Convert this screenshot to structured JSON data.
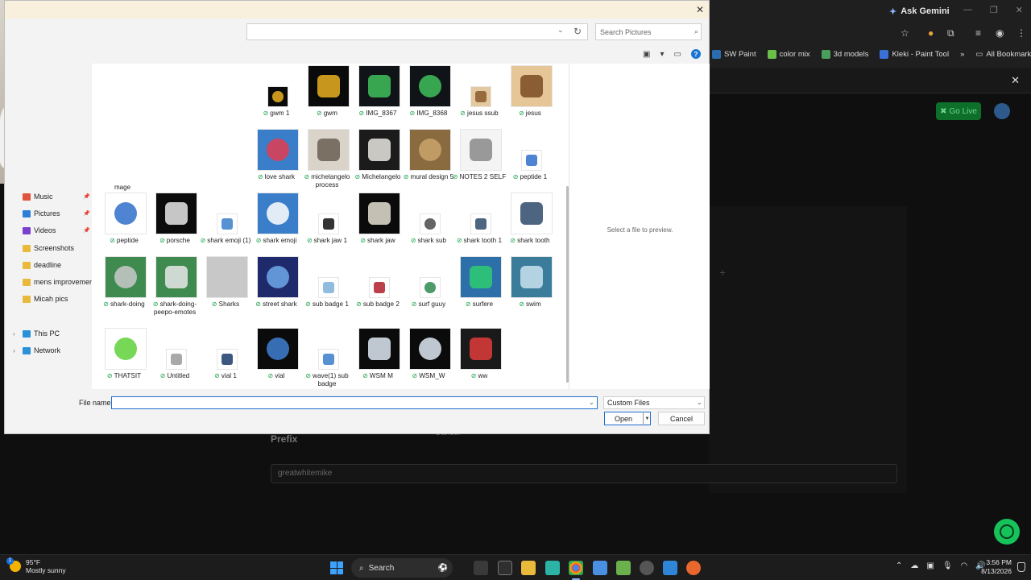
{
  "browser": {
    "gemini_label": "Ask Gemini",
    "bookmarks": [
      {
        "label": "SW Paint",
        "color": "#2b6cb0"
      },
      {
        "label": "color mix",
        "color": "#6abf4b"
      },
      {
        "label": "3d models",
        "color": "#4a9e5c"
      },
      {
        "label": "Kleki - Paint Tool",
        "color": "#3a6fd8"
      }
    ],
    "all_bookmarks": "All Bookmarks",
    "go_live": "Go Live",
    "prefix_label": "Prefix",
    "prefix_value": "greatwhitemike",
    "cancel_label": "Cancel"
  },
  "dialog": {
    "search_placeholder": "Search Pictures",
    "preview_text": "Select a file to preview.",
    "cut_label": "mage",
    "nav": [
      {
        "label": "Music",
        "color": "#e0533d",
        "pinned": true
      },
      {
        "label": "Pictures",
        "color": "#2f7fd8",
        "pinned": true
      },
      {
        "label": "Videos",
        "color": "#7b3fcf",
        "pinned": true
      },
      {
        "label": "Screenshots",
        "color": "#e8b93a",
        "pinned": false
      },
      {
        "label": "deadline",
        "color": "#e8b93a",
        "pinned": false
      },
      {
        "label": "mens improvement",
        "color": "#e8b93a",
        "pinned": false
      },
      {
        "label": "Micah pics",
        "color": "#e8b93a",
        "pinned": false
      },
      {
        "label": "This PC",
        "color": "#2a90d8",
        "pinned": false
      },
      {
        "label": "Network",
        "color": "#2a90d8",
        "pinned": false
      }
    ],
    "files": [
      {
        "label": "gwm 1",
        "bg": "#0a0a0a",
        "fg": "#e8b020",
        "icon": "gwm-logo-small-icon"
      },
      {
        "label": "gwm",
        "bg": "#0a0a0a",
        "fg": "#e8b020",
        "icon": "gwm-logo-icon"
      },
      {
        "label": "IMG_8367",
        "bg": "#101418",
        "fg": "#3fbf5a",
        "icon": "phone-screenshot-icon"
      },
      {
        "label": "IMG_8368",
        "bg": "#101418",
        "fg": "#3fbf5a",
        "icon": "phone-screenshot-icon"
      },
      {
        "label": "jesus ssub",
        "bg": "#e3c9a0",
        "fg": "#8a5a2b",
        "icon": "portrait-small-icon"
      },
      {
        "label": "jesus",
        "bg": "#e6c697",
        "fg": "#7a4a22",
        "icon": "portrait-icon"
      },
      {
        "label": "love shark",
        "bg": "#3a7ec9",
        "fg": "#e23c4f",
        "icon": "shark-heart-icon"
      },
      {
        "label": "michelangelo process",
        "bg": "#d9d3c9",
        "fg": "#6a5e52",
        "icon": "sculpture-icon"
      },
      {
        "label": "Michelangelo",
        "bg": "#1b1b1b",
        "fg": "#e9e6e0",
        "icon": "statue-head-icon"
      },
      {
        "label": "mural design 5",
        "bg": "#8a6a3f",
        "fg": "#c9a36b",
        "icon": "mural-icon"
      },
      {
        "label": "NOTES 2 SELF",
        "bg": "#f4f4f4",
        "fg": "#888888",
        "icon": "notes-icon"
      },
      {
        "label": "peptide 1",
        "bg": "#ffffff",
        "fg": "#2f6fc9",
        "icon": "syringe-small-icon"
      },
      {
        "label": "peptide",
        "bg": "#ffffff",
        "fg": "#2f6fc9",
        "icon": "syringe-icon"
      },
      {
        "label": "porsche",
        "bg": "#0b0b0b",
        "fg": "#e8e8e8",
        "icon": "car-icon"
      },
      {
        "label": "shark emoji (1)",
        "bg": "#ffffff",
        "fg": "#3a7ec9",
        "icon": "shark-emoji-small-icon"
      },
      {
        "label": "shark emoji",
        "bg": "#3a7ec9",
        "fg": "#ffffff",
        "icon": "shark-emoji-icon"
      },
      {
        "label": "shark jaw 1",
        "bg": "#ffffff",
        "fg": "#111111",
        "icon": "jaw-small-icon"
      },
      {
        "label": "shark jaw",
        "bg": "#0b0b0b",
        "fg": "#e6e0d2",
        "icon": "jaw-icon"
      },
      {
        "label": "shark sub",
        "bg": "#ffffff",
        "fg": "#4a4a4a",
        "icon": "shark-sub-icon"
      },
      {
        "label": "shark tooth 1",
        "bg": "#ffffff",
        "fg": "#2e4a6b",
        "icon": "tooth-small-icon"
      },
      {
        "label": "shark tooth",
        "bg": "#ffffff",
        "fg": "#2e4a6b",
        "icon": "tooth-icon"
      },
      {
        "label": "shark-doing",
        "bg": "#3f8a4f",
        "fg": "#c9c9c9",
        "icon": "shark-icon"
      },
      {
        "label": "shark-doing-peepo-emotes",
        "bg": "#3f8a4f",
        "fg": "#e8e8e8",
        "icon": "shark-face-icon"
      },
      {
        "label": "Sharks",
        "bg": "#c8c8c8",
        "fg": "#c8c8c8",
        "icon": "folder-thumb-icon"
      },
      {
        "label": "street shark",
        "bg": "#1e2a6b",
        "fg": "#6fa8e8",
        "icon": "street-shark-icon"
      },
      {
        "label": "sub badge 1",
        "bg": "#ffffff",
        "fg": "#7fb0d9",
        "icon": "badge-small-icon"
      },
      {
        "label": "sub badge 2",
        "bg": "#ffffff",
        "fg": "#b01e2a",
        "icon": "badge-icon"
      },
      {
        "label": "surf guuy",
        "bg": "#ffffff",
        "fg": "#2f8a4f",
        "icon": "surfer-small-icon"
      },
      {
        "label": "surfere",
        "bg": "#2d6fa8",
        "fg": "#2ecc71",
        "icon": "surfer-icon"
      },
      {
        "label": "swim",
        "bg": "#3a7c9a",
        "fg": "#c9e3ef",
        "icon": "swim-icon"
      },
      {
        "label": "THATSIT",
        "bg": "#ffffff",
        "fg": "#5fd03a",
        "icon": "text-art-icon"
      },
      {
        "label": "Untitled",
        "bg": "#ffffff",
        "fg": "#9a9a9a",
        "icon": "sketch-icon"
      },
      {
        "label": "vial 1",
        "bg": "#ffffff",
        "fg": "#1b3a6b",
        "icon": "vial-small-icon"
      },
      {
        "label": "vial",
        "bg": "#0b0b0b",
        "fg": "#3f7fd0",
        "icon": "vial-icon"
      },
      {
        "label": "wave(1) sub badge",
        "bg": "#ffffff",
        "fg": "#3a7ec9",
        "icon": "wave-icon"
      },
      {
        "label": "WSM M",
        "bg": "#0b0b0b",
        "fg": "#dfe9f5",
        "icon": "hand-icon"
      },
      {
        "label": "WSM_W",
        "bg": "#0b0b0b",
        "fg": "#dfe9f5",
        "icon": "hand-w-icon"
      },
      {
        "label": "ww",
        "bg": "#1a1a1a",
        "fg": "#e23c3c",
        "icon": "w-logo-icon"
      }
    ],
    "file_name_label": "File name:",
    "file_name_value": "",
    "filter_label": "Custom Files",
    "open_label": "Open",
    "cancel_label": "Cancel"
  },
  "taskbar": {
    "weather_temp": "95°F",
    "weather_desc": "Mostly sunny",
    "weather_badge": "1",
    "search_label": "Search",
    "time": "3:56 PM",
    "date": "8/13/2026"
  }
}
